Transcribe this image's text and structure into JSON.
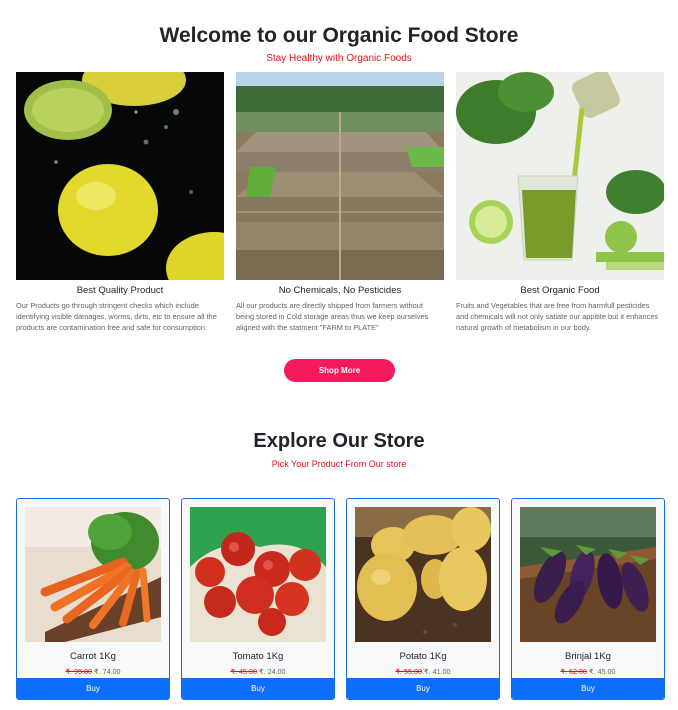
{
  "hero": {
    "title": "Welcome to our Organic Food Store",
    "subtitle": "Stay Healthy with Organic Foods"
  },
  "features": [
    {
      "title": "Best Quality Product",
      "description": "Our Products go through stringent checks which include identifying visible damages, worms, dirts, etc to ensure all the products are contamination free and safe for consumption."
    },
    {
      "title": "No Chemicals, No Pesticides",
      "description": "All our products are directly shipped from farmers without being stored in Cold storage areas thus we keep ourselves aligned with the statment \"FARM to PLATE\""
    },
    {
      "title": "Best Organic Food",
      "description": "Fruits and Vegetables that are free from harmfull pesticides and chemicals will not only satiate our appitite but it enhances natural growth of metabolism in our body."
    }
  ],
  "shop_more_label": "Shop More",
  "explore": {
    "title": "Explore Our Store",
    "subtitle": "Pick Your Product From Our store"
  },
  "products": [
    {
      "name": "Carrot 1Kg",
      "old_price": "₹. 95.00",
      "price": "₹. 74.00",
      "buy_label": "Buy"
    },
    {
      "name": "Tomato 1Kg",
      "old_price": "₹. 45.00",
      "price": "₹. 24.00",
      "buy_label": "Buy"
    },
    {
      "name": "Potato 1Kg",
      "old_price": "₹. 55.00",
      "price": "₹. 41.00",
      "buy_label": "Buy"
    },
    {
      "name": "Brinjal 1Kg",
      "old_price": "₹. 62.00",
      "price": "₹. 45.00",
      "buy_label": "Buy"
    }
  ],
  "colors": {
    "accent_red": "#e8101b",
    "shop_button": "#f31b5b",
    "buy_button": "#0d6efd",
    "card_border": "#1a6fd4"
  }
}
